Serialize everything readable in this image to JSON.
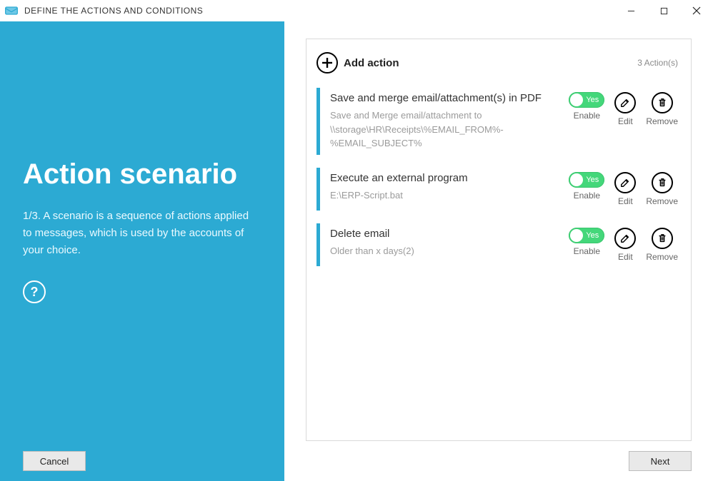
{
  "window": {
    "title": "DEFINE THE ACTIONS AND CONDITIONS"
  },
  "sidebar": {
    "heading": "Action scenario",
    "subtitle": "1/3. A scenario is a sequence of actions applied to messages, which is used by the accounts of your choice.",
    "help_glyph": "?",
    "cancel_label": "Cancel"
  },
  "panel": {
    "add_label": "Add action",
    "count_text": "3  Action(s)",
    "toggle_yes": "Yes",
    "enable_label": "Enable",
    "edit_label": "Edit",
    "remove_label": "Remove",
    "next_label": "Next",
    "actions": [
      {
        "title": "Save and merge email/attachment(s) in PDF",
        "sub": "Save and Merge email/attachment to \\\\storage\\HR\\Receipts\\%EMAIL_FROM%-%EMAIL_SUBJECT%"
      },
      {
        "title": "Execute an external program",
        "sub": "E:\\ERP-Script.bat"
      },
      {
        "title": "Delete email",
        "sub": "Older than x days(2)"
      }
    ]
  }
}
